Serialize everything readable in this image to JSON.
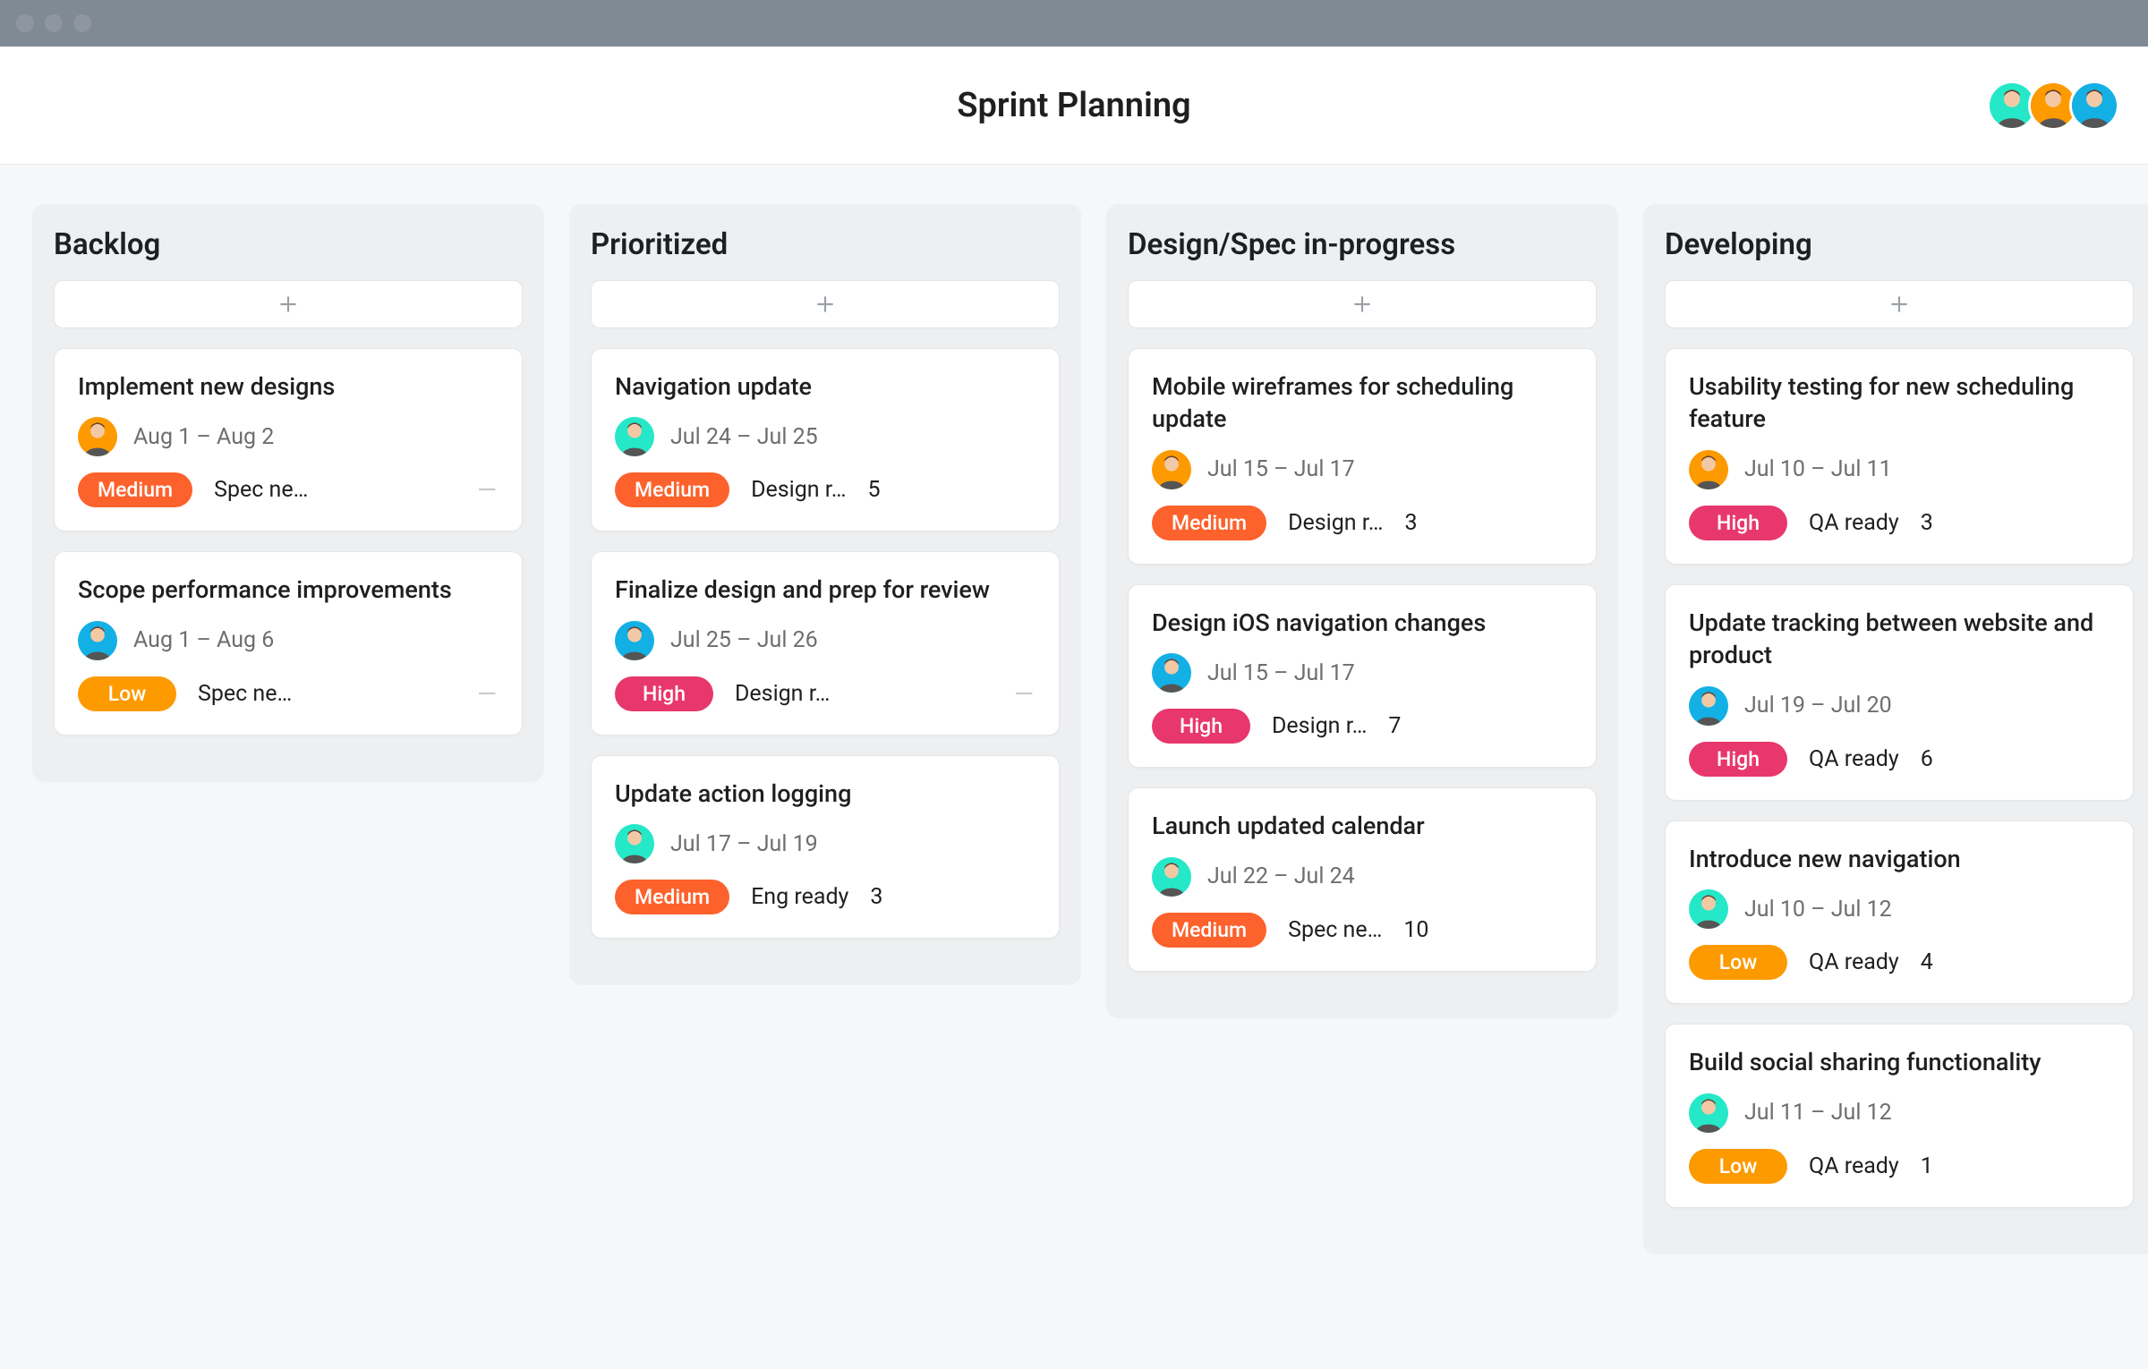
{
  "header": {
    "title": "Sprint Planning",
    "collaborators": [
      {
        "color": "#25e8c8"
      },
      {
        "color": "#fd9a00"
      },
      {
        "color": "#13b0e6"
      }
    ]
  },
  "avatar_colors": {
    "teal": "#25e8c8",
    "orange": "#fd9a00",
    "blue": "#13b0e6"
  },
  "priority_colors": {
    "High": "#e8376d",
    "Medium": "#fd612c",
    "Low": "#fd9a00"
  },
  "columns": [
    {
      "title": "Backlog",
      "cards": [
        {
          "title": "Implement new designs",
          "assignee_color": "orange",
          "dates": "Aug 1 – Aug 2",
          "priority": "Medium",
          "status": "Spec ne…",
          "count": null,
          "trailing_dash": true
        },
        {
          "title": "Scope performance improvements",
          "assignee_color": "blue",
          "dates": "Aug 1 – Aug 6",
          "priority": "Low",
          "status": "Spec ne…",
          "count": null,
          "trailing_dash": true
        }
      ]
    },
    {
      "title": "Prioritized",
      "cards": [
        {
          "title": "Navigation update",
          "assignee_color": "teal",
          "dates": "Jul 24 – Jul 25",
          "priority": "Medium",
          "status": "Design r…",
          "count": 5,
          "trailing_dash": false
        },
        {
          "title": "Finalize design and prep for review",
          "assignee_color": "blue",
          "dates": "Jul 25 – Jul 26",
          "priority": "High",
          "status": "Design r…",
          "count": null,
          "trailing_dash": true
        },
        {
          "title": "Update action logging",
          "assignee_color": "teal",
          "dates": "Jul 17 – Jul 19",
          "priority": "Medium",
          "status": "Eng ready",
          "count": 3,
          "trailing_dash": false
        }
      ]
    },
    {
      "title": "Design/Spec in-progress",
      "cards": [
        {
          "title": "Mobile wireframes for scheduling update",
          "assignee_color": "orange",
          "dates": "Jul 15 – Jul 17",
          "priority": "Medium",
          "status": "Design r…",
          "count": 3,
          "trailing_dash": false
        },
        {
          "title": "Design iOS navigation changes",
          "assignee_color": "blue",
          "dates": "Jul 15 – Jul 17",
          "priority": "High",
          "status": "Design r…",
          "count": 7,
          "trailing_dash": false
        },
        {
          "title": "Launch updated calendar",
          "assignee_color": "teal",
          "dates": "Jul 22 – Jul 24",
          "priority": "Medium",
          "status": "Spec ne…",
          "count": 10,
          "trailing_dash": false
        }
      ]
    },
    {
      "title": "Developing",
      "cards": [
        {
          "title": "Usability testing for new scheduling feature",
          "assignee_color": "orange",
          "dates": "Jul 10 – Jul 11",
          "priority": "High",
          "status": "QA ready",
          "count": 3,
          "trailing_dash": false
        },
        {
          "title": "Update tracking between website and product",
          "assignee_color": "blue",
          "dates": "Jul 19 – Jul 20",
          "priority": "High",
          "status": "QA ready",
          "count": 6,
          "trailing_dash": false
        },
        {
          "title": "Introduce new navigation",
          "assignee_color": "teal",
          "dates": "Jul 10 – Jul 12",
          "priority": "Low",
          "status": "QA ready",
          "count": 4,
          "trailing_dash": false
        },
        {
          "title": "Build social sharing functionality",
          "assignee_color": "teal",
          "dates": "Jul 11 – Jul 12",
          "priority": "Low",
          "status": "QA ready",
          "count": 1,
          "trailing_dash": false
        }
      ]
    }
  ]
}
